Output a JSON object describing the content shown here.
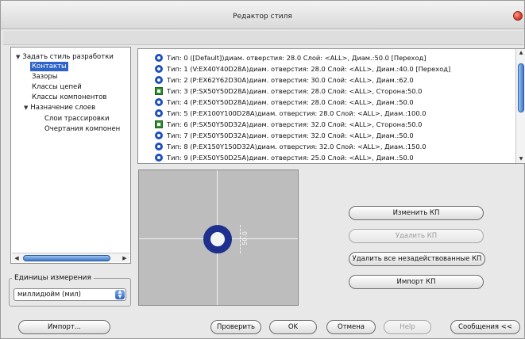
{
  "window": {
    "title": "Редактор стиля"
  },
  "tree": {
    "items": [
      {
        "label": "Задать стиль разработки",
        "expanded": true,
        "level": 0,
        "selected": false
      },
      {
        "label": "Контакты",
        "level": 1,
        "selected": true
      },
      {
        "label": "Зазоры",
        "level": 1,
        "selected": false
      },
      {
        "label": "Классы цепей",
        "level": 1,
        "selected": false
      },
      {
        "label": "Классы компонентов",
        "level": 1,
        "selected": false
      },
      {
        "label": "Назначение слоев",
        "expanded": true,
        "level": 1,
        "selected": false
      },
      {
        "label": "Слои трассировки",
        "level": 2,
        "selected": false
      },
      {
        "label": "Очертания компонен",
        "level": 2,
        "selected": false
      }
    ]
  },
  "units": {
    "label": "Единицы измерения",
    "value": "миллидюйм (мил)"
  },
  "pads": [
    {
      "shape": "round",
      "text": "Тип: 0 ([Default])диам. отверстия: 28.0 Слой: <ALL>, Диам.:50.0  [Переход]"
    },
    {
      "shape": "round",
      "text": "Тип: 1 (V:EX40Y40D28A)диам. отверстия: 28.0 Слой: <ALL>, Диам.:40.0  [Переход]"
    },
    {
      "shape": "round",
      "text": "Тип: 2 (P:EX62Y62D30A)диам. отверстия: 30.0 Слой: <ALL>, Диам.:62.0"
    },
    {
      "shape": "square",
      "text": "Тип: 3 (P:SX50Y50D28A)диам. отверстия: 28.0 Слой: <ALL>, Сторона:50.0"
    },
    {
      "shape": "round",
      "text": "Тип: 4 (P:EX50Y50D28A)диам. отверстия: 28.0 Слой: <ALL>, Диам.:50.0"
    },
    {
      "shape": "round",
      "text": "Тип: 5 (P:EX100Y100D28A)диам. отверстия: 28.0 Слой: <ALL>, Диам.:100.0"
    },
    {
      "shape": "square",
      "text": "Тип: 6 (P:SX50Y50D32A)диам. отверстия: 32.0 Слой: <ALL>, Сторона:50.0"
    },
    {
      "shape": "round",
      "text": "Тип: 7 (P:EX50Y50D32A)диам. отверстия: 32.0 Слой: <ALL>, Диам.:50.0"
    },
    {
      "shape": "round",
      "text": "Тип: 8 (P:EX150Y150D32A)диам. отверстия: 32.0 Слой: <ALL>, Диам.:150.0"
    },
    {
      "shape": "round",
      "text": "Тип: 9 (P:EX50Y50D25A)диам. отверстия: 25.0 Слой: <ALL>, Диам.:50.0"
    }
  ],
  "preview": {
    "dimension": "50.0"
  },
  "buttons": {
    "change_pad": "Изменить КП",
    "delete_pad": "Удалить КП",
    "delete_unused": "Удалить все незадействованные КП",
    "import_pad": "Импорт КП",
    "import": "Импорт...",
    "check": "Проверить",
    "ok": "OK",
    "cancel": "Отмена",
    "help": "Help",
    "messages": "Сообщения <<"
  },
  "colors": {
    "selection": "#2f63c9",
    "round_pad": "#1d4fbf",
    "square_pad": "#2f8f2f",
    "preview_pad": "#1f2f8e"
  }
}
